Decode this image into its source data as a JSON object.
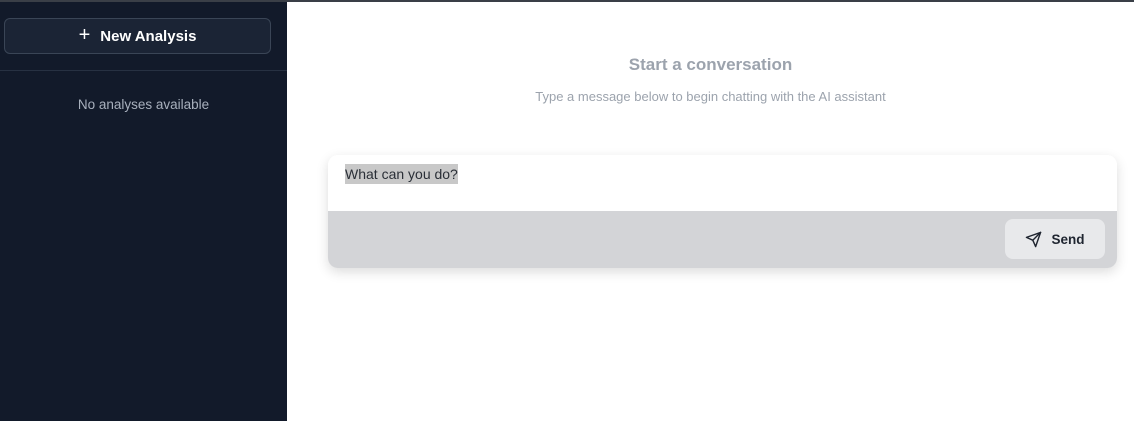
{
  "sidebar": {
    "new_analysis_label": "New Analysis",
    "new_analysis_icon": "plus-icon",
    "empty_text": "No analyses available"
  },
  "main": {
    "heading": "Start a conversation",
    "subheading": "Type a message below to begin chatting with the AI assistant",
    "input_value": "What can you do?",
    "send_label": "Send",
    "send_icon": "send-icon"
  },
  "colors": {
    "sidebar_bg": "#121a2a",
    "composer_bar_bg": "#d3d4d7",
    "heading_text": "#9ca3ad"
  }
}
